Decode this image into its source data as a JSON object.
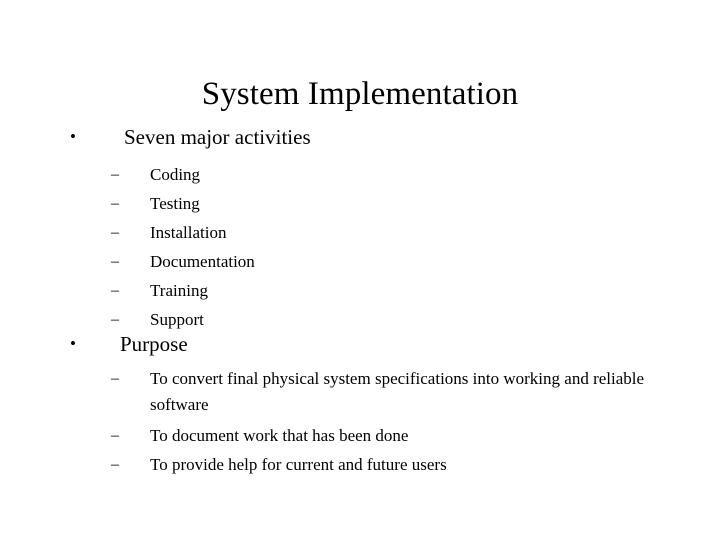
{
  "slide": {
    "title": "System Implementation",
    "background_color": "#ffffff",
    "text_color": "#000000",
    "level1_marker": "•",
    "level2_marker": "–",
    "sections": [
      {
        "heading": "Seven major activities",
        "items": [
          "Coding",
          "Testing",
          "Installation",
          "Documentation",
          "Training",
          "Support"
        ]
      },
      {
        "heading": "Purpose",
        "items": [
          "To convert final physical system specifications into working and reliable software",
          "To document work that has been done",
          "To provide help for current and future users"
        ]
      }
    ]
  }
}
